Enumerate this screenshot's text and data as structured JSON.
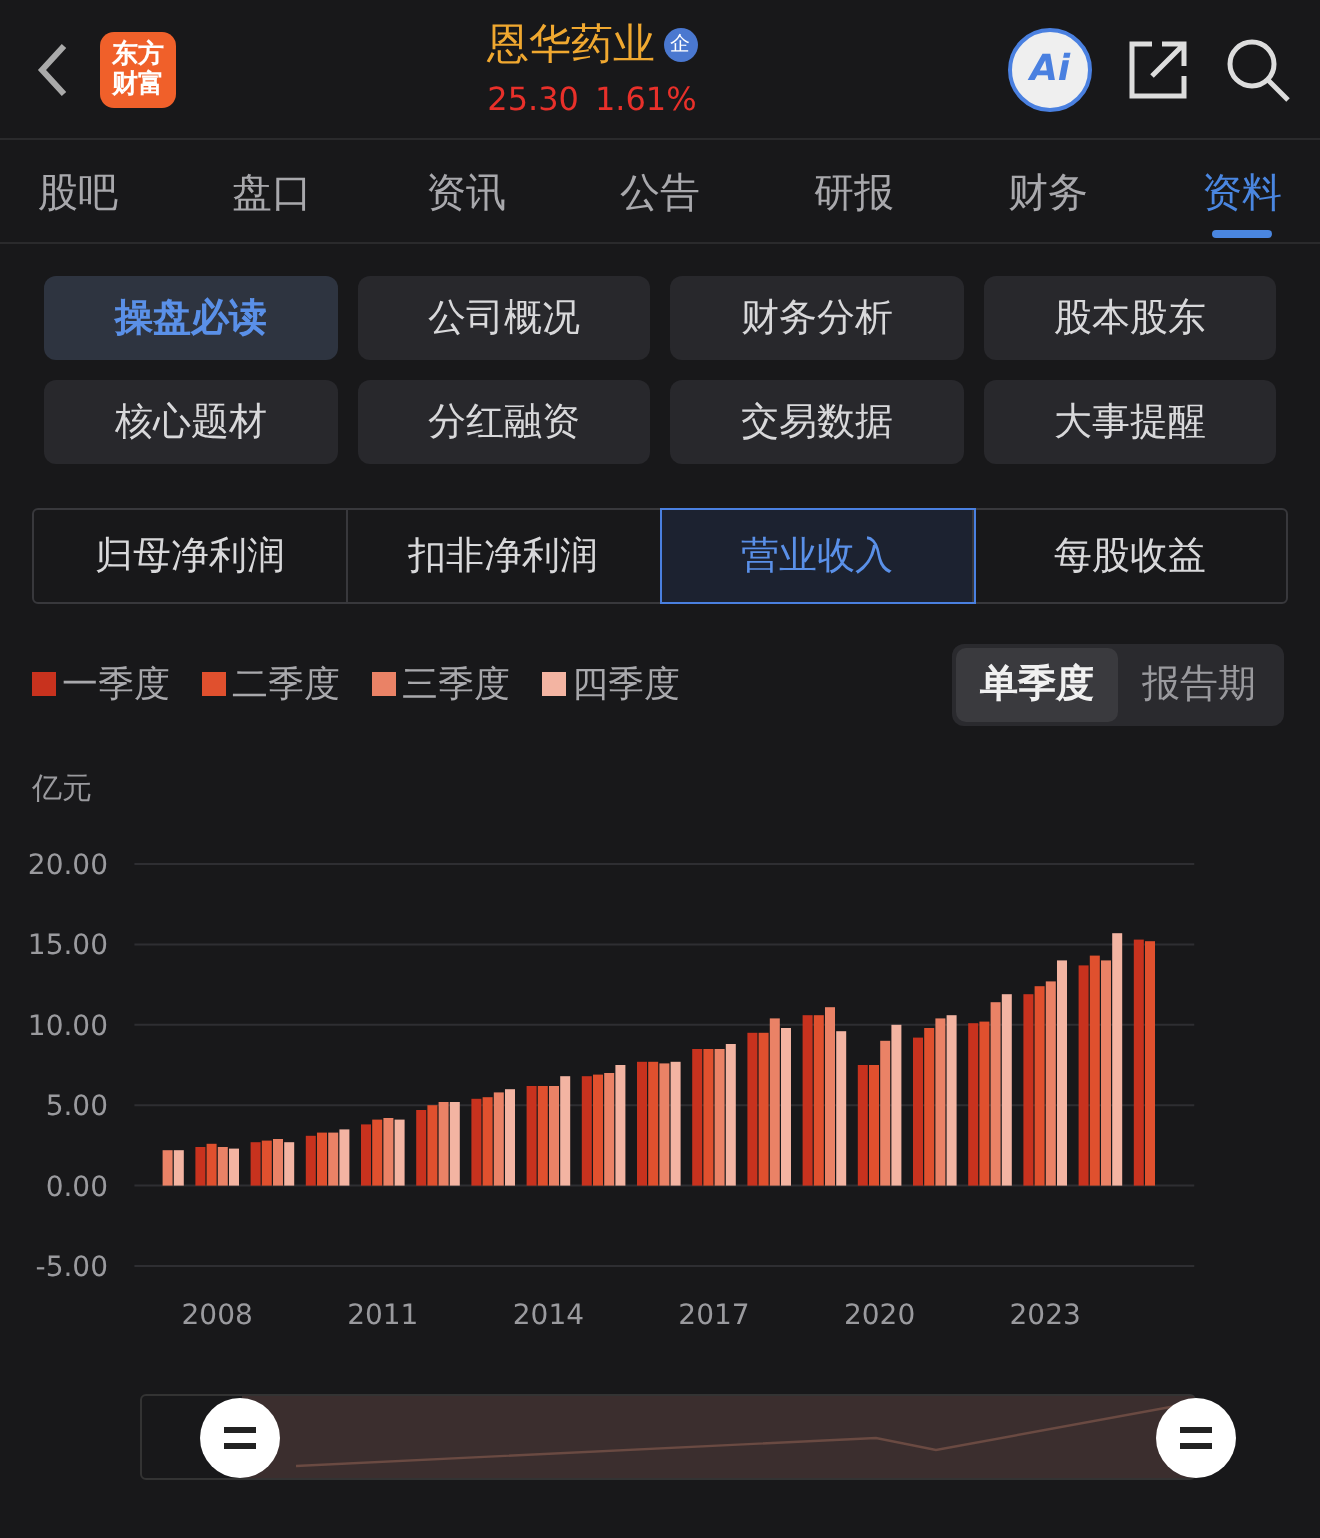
{
  "header": {
    "logo_text": "东方财富",
    "title": "恩华药业",
    "badge": "企",
    "price": "25.30",
    "change": "1.61%",
    "ai_label": "Ai"
  },
  "tabs": [
    {
      "label": "股吧",
      "selected": false
    },
    {
      "label": "盘口",
      "selected": false
    },
    {
      "label": "资讯",
      "selected": false
    },
    {
      "label": "公告",
      "selected": false
    },
    {
      "label": "研报",
      "selected": false
    },
    {
      "label": "财务",
      "selected": false
    },
    {
      "label": "资料",
      "selected": true
    }
  ],
  "sections": [
    {
      "label": "操盘必读",
      "selected": true
    },
    {
      "label": "公司概况",
      "selected": false
    },
    {
      "label": "财务分析",
      "selected": false
    },
    {
      "label": "股本股东",
      "selected": false
    },
    {
      "label": "核心题材",
      "selected": false
    },
    {
      "label": "分红融资",
      "selected": false
    },
    {
      "label": "交易数据",
      "selected": false
    },
    {
      "label": "大事提醒",
      "selected": false
    }
  ],
  "metrics": [
    {
      "label": "归母净利润",
      "selected": false
    },
    {
      "label": "扣非净利润",
      "selected": false
    },
    {
      "label": "营业收入",
      "selected": true
    },
    {
      "label": "每股收益",
      "selected": false
    }
  ],
  "period_toggle": [
    {
      "label": "单季度",
      "selected": true
    },
    {
      "label": "报告期",
      "selected": false
    }
  ],
  "chart_data": {
    "type": "bar",
    "ylabel": "亿元",
    "x": [
      2007,
      2008,
      2009,
      2010,
      2011,
      2012,
      2013,
      2014,
      2015,
      2016,
      2017,
      2018,
      2019,
      2020,
      2021,
      2022,
      2023,
      2024,
      2025
    ],
    "xticks": [
      2008,
      2011,
      2014,
      2017,
      2020,
      2023
    ],
    "grid": true,
    "xlim": [
      2006.5,
      2025.7
    ],
    "yticks": [
      {
        "value": 20,
        "label": "20.00"
      },
      {
        "value": 15,
        "label": "15.00"
      },
      {
        "value": 10,
        "label": "10.00"
      },
      {
        "value": 5,
        "label": "5.00"
      },
      {
        "value": 0,
        "label": "0.00"
      },
      {
        "value": -5,
        "label": "-5.00"
      }
    ],
    "ylim": [
      -5,
      20
    ],
    "series": [
      {
        "name": "一季度",
        "color": "#c8321e",
        "values": [
          null,
          2.4,
          2.7,
          3.1,
          3.8,
          4.7,
          5.4,
          6.2,
          6.8,
          7.7,
          8.5,
          9.5,
          10.6,
          7.5,
          9.2,
          10.1,
          11.9,
          13.7,
          15.3
        ]
      },
      {
        "name": "二季度",
        "color": "#e0502e",
        "values": [
          null,
          2.6,
          2.8,
          3.3,
          4.1,
          5.0,
          5.5,
          6.2,
          6.9,
          7.7,
          8.5,
          9.5,
          10.6,
          7.5,
          9.8,
          10.2,
          12.4,
          14.3,
          15.2
        ]
      },
      {
        "name": "三季度",
        "color": "#ea8266",
        "values": [
          2.2,
          2.4,
          2.9,
          3.3,
          4.2,
          5.2,
          5.8,
          6.2,
          7.0,
          7.6,
          8.5,
          10.4,
          11.1,
          9.0,
          10.4,
          11.4,
          12.7,
          14.0,
          null
        ]
      },
      {
        "name": "四季度",
        "color": "#f3b4a2",
        "values": [
          2.2,
          2.3,
          2.7,
          3.5,
          4.1,
          5.2,
          6.0,
          6.8,
          7.5,
          7.7,
          8.8,
          9.8,
          9.6,
          10.0,
          10.6,
          11.9,
          14.0,
          15.7,
          null
        ]
      }
    ]
  }
}
